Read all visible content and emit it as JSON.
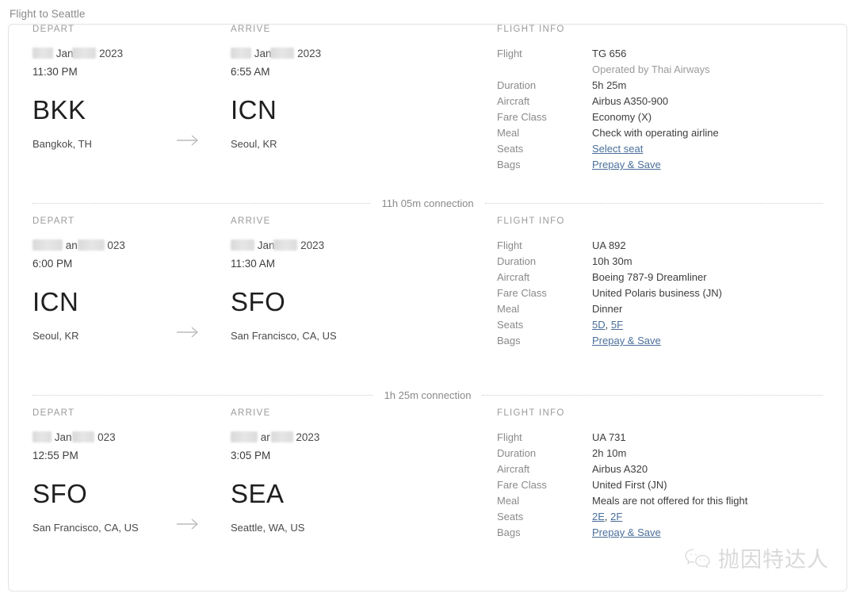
{
  "page": {
    "title": "Flight to Seattle"
  },
  "labels": {
    "depart": "DEPART",
    "arrive": "ARRIVE",
    "flight_info": "FLIGHT INFO",
    "flight": "Flight",
    "duration": "Duration",
    "aircraft": "Aircraft",
    "fare_class": "Fare Class",
    "meal": "Meal",
    "seats": "Seats",
    "bags": "Bags"
  },
  "common": {
    "bags_link": "Prepay & Save",
    "arrow_icon": "arrow-right-icon"
  },
  "segments": [
    {
      "depart": {
        "date_month": "Jan",
        "date_year": "2023",
        "time": "11:30 PM",
        "code": "BKK",
        "city": "Bangkok, TH"
      },
      "arrive": {
        "date_month": "Jan",
        "date_year": "2023",
        "time": "6:55 AM",
        "code": "ICN",
        "city": "Seoul, KR"
      },
      "info": {
        "flight": "TG 656",
        "operated_by": "Operated by Thai Airways",
        "duration": "5h 25m",
        "aircraft": "Airbus A350-900",
        "fare_class": "Economy (X)",
        "meal": "Check with operating airline",
        "seats": [
          "Select seat"
        ],
        "bags": "Prepay & Save"
      }
    },
    {
      "depart": {
        "date_month": "an",
        "date_year": "023",
        "time": "6:00 PM",
        "code": "ICN",
        "city": "Seoul, KR"
      },
      "arrive": {
        "date_month": "Jan",
        "date_year": "2023",
        "time": "11:30 AM",
        "code": "SFO",
        "city": "San Francisco, CA, US"
      },
      "info": {
        "flight": "UA 892",
        "operated_by": "",
        "duration": "10h 30m",
        "aircraft": "Boeing 787-9 Dreamliner",
        "fare_class": "United Polaris business (JN)",
        "meal": "Dinner",
        "seats": [
          "5D",
          "5F"
        ],
        "bags": "Prepay & Save"
      }
    },
    {
      "depart": {
        "date_month": "Jan",
        "date_year": "023",
        "time": "12:55 PM",
        "code": "SFO",
        "city": "San Francisco, CA, US"
      },
      "arrive": {
        "date_month": "ar",
        "date_year": "2023",
        "time": "3:05 PM",
        "code": "SEA",
        "city": "Seattle, WA, US"
      },
      "info": {
        "flight": "UA 731",
        "operated_by": "",
        "duration": "2h 10m",
        "aircraft": "Airbus A320",
        "fare_class": "United First (JN)",
        "meal": "Meals are not offered for this flight",
        "seats": [
          "2E",
          "2F"
        ],
        "bags": "Prepay & Save"
      }
    }
  ],
  "connections": [
    {
      "label": "11h 05m connection"
    },
    {
      "label": "1h 25m connection"
    }
  ],
  "watermark": {
    "text": "抛因特达人",
    "logo": "wechat-icon"
  },
  "colors": {
    "link": "#4a6f9a",
    "label": "#8a8a8a",
    "value": "#3d3d3d",
    "border": "#e2e2e2"
  }
}
